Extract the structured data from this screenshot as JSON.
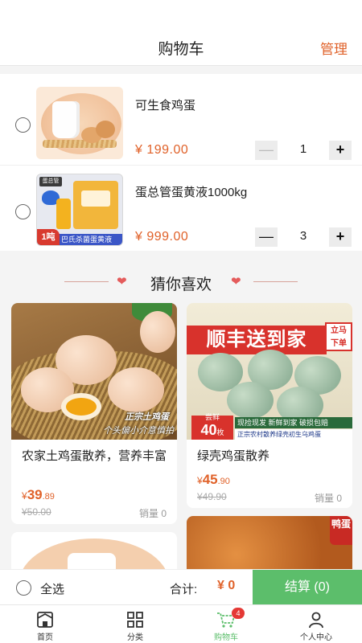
{
  "header": {
    "title": "购物车",
    "manage": "管理"
  },
  "cart": {
    "items": [
      {
        "name": "可生食鸡蛋",
        "price": "¥ 199.00",
        "qty": "1",
        "minus": "—",
        "plus": "+"
      },
      {
        "name": "蛋总管蛋黄液1000kg",
        "price": "¥ 999.00",
        "qty": "3",
        "minus": "—",
        "plus": "+",
        "img_logo": "蛋总管",
        "img_badge": "1吨",
        "img_banner": "巴氏杀菌蛋黄液"
      }
    ]
  },
  "recommend": {
    "heading": "猜你喜欢",
    "cards": [
      {
        "title": "农家土鸡蛋散养，营养丰富",
        "cur": "¥",
        "int": "39",
        "dec": ".89",
        "old": "¥50.00",
        "sales": "销量 0",
        "cap1": "正宗土鸡蛋",
        "cap2": "个头偏小介意慎拍"
      },
      {
        "title": "绿壳鸡蛋散养",
        "cur": "¥",
        "int": "45",
        "dec": ".90",
        "old": "¥49.90",
        "sales": "销量 0",
        "promo": "顺丰送到家",
        "sticker1": "立马",
        "sticker2": "下单",
        "fresh": "尝鲜",
        "count": "40",
        "unit": "枚",
        "strip1": "现捡现发 新鲜到家 破损包赔",
        "strip2": "正宗农村散养绿壳初生乌鸡蛋"
      },
      {},
      {
        "tag": "鸭蛋"
      }
    ]
  },
  "checkout": {
    "select_all": "全选",
    "total_label": "合计:",
    "total": "¥ 0",
    "settle": "结算 (0)"
  },
  "tabbar": {
    "items": [
      {
        "label": "首页",
        "icon": "home-icon"
      },
      {
        "label": "分类",
        "icon": "grid-icon"
      },
      {
        "label": "购物车",
        "icon": "cart-icon",
        "badge": "4",
        "active": true
      },
      {
        "label": "个人中心",
        "icon": "user-icon"
      }
    ]
  },
  "colors": {
    "accent": "#e0622a",
    "green": "#5cbe6b",
    "badge": "#e53935"
  }
}
